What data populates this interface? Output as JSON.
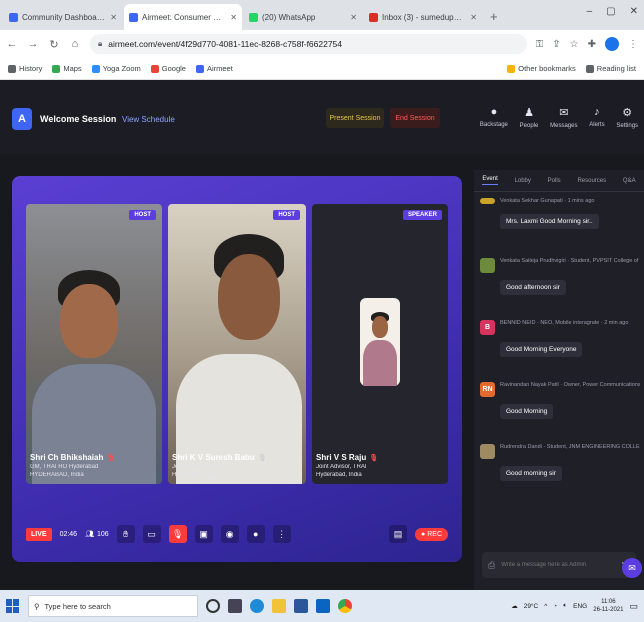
{
  "browser": {
    "tabs": [
      {
        "label": "Community Dashboard - Vibe",
        "active": false,
        "color": "#3f66f3"
      },
      {
        "label": "Airmeet: Consumer Session",
        "active": true,
        "color": "#3f66f3"
      },
      {
        "label": "(20) WhatsApp",
        "active": false,
        "color": "#25d366"
      },
      {
        "label": "Inbox (3) - sumedup@gmail.c",
        "active": false,
        "color": "#d93025"
      }
    ],
    "new_tab": "+",
    "window_controls": [
      "–",
      "▢",
      "✕"
    ],
    "url": "airmeet.com/event/4f29d770-4081-11ec-8268-c758f-f6622754",
    "bookmarks": [
      "History",
      "Maps",
      "Yoga Zoom",
      "Google",
      "Airmeet"
    ],
    "bookmarks_right": [
      "Other bookmarks",
      "Reading list"
    ]
  },
  "header": {
    "title": "Welcome Session",
    "schedule_link": "View Schedule",
    "present_button": "Present Session",
    "end_button": "End Session"
  },
  "side_tools": [
    {
      "icon": "●",
      "label": "Backstage"
    },
    {
      "icon": "♟",
      "label": "People"
    },
    {
      "icon": "✉",
      "label": "Messages"
    },
    {
      "icon": "♪",
      "label": "Alerts"
    },
    {
      "icon": "⚙",
      "label": "Settings"
    }
  ],
  "stage": {
    "participants": [
      {
        "role": "HOST",
        "name": "Shri Ch Bhikshaiah",
        "subtitle": "GM, TRAI RO Hyderabad",
        "location": "HYDERABAD, India"
      },
      {
        "role": "HOST",
        "name": "Shri K V Suresh Babu",
        "subtitle": "Joint Advisor, TRAI",
        "location": "Hyderabad, India"
      },
      {
        "role": "SPEAKER",
        "name": "Shri V S Raju",
        "subtitle": "Joint Advisor, TRAI",
        "location": "Hyderabad, India"
      }
    ],
    "controls": {
      "live": "LIVE",
      "timer": "02:46",
      "attendees": "106",
      "record": "● REC"
    }
  },
  "chat": {
    "tabs": [
      "Event",
      "Lobby",
      "Polls",
      "Resources",
      "Q&A"
    ],
    "active_tab": "Event",
    "messages": [
      {
        "initials": "",
        "avatar_color": "#c9a227",
        "meta": "Venkata Sekhar Gunapati · 1 mins ago",
        "text": "Mrs. Laxmi Good Morning sir.."
      },
      {
        "initials": "",
        "avatar_color": "#6d8b3a",
        "meta": "Venkata Saiteja Prudhvigiri · Student, PVPSIT College of engine... 2 mins ago",
        "text": "Good afternoon sir"
      },
      {
        "initials": "B",
        "avatar_color": "#d6335e",
        "meta": "BENNID NEID · NEO, Mobile interagrate · 2 min ago",
        "text": "Good Morning Everyone"
      },
      {
        "initials": "RN",
        "avatar_color": "#e36a2f",
        "meta": "Ravinandan Nayak Patil · Owner, Power Communications · just now",
        "text": "Good Morning"
      },
      {
        "initials": "",
        "avatar_color": "#9e8a63",
        "meta": "Rudrendra Dandi · Student, JNM ENGINEERING COLLE... just now",
        "text": "Good morning sir"
      }
    ],
    "input_placeholder": "Write a message here as Admin",
    "send": "➤"
  },
  "taskbar": {
    "search_placeholder": "Type here to search",
    "weather": "29°C",
    "language": "ENG",
    "time": "11:06",
    "date": "26-11-2021"
  }
}
